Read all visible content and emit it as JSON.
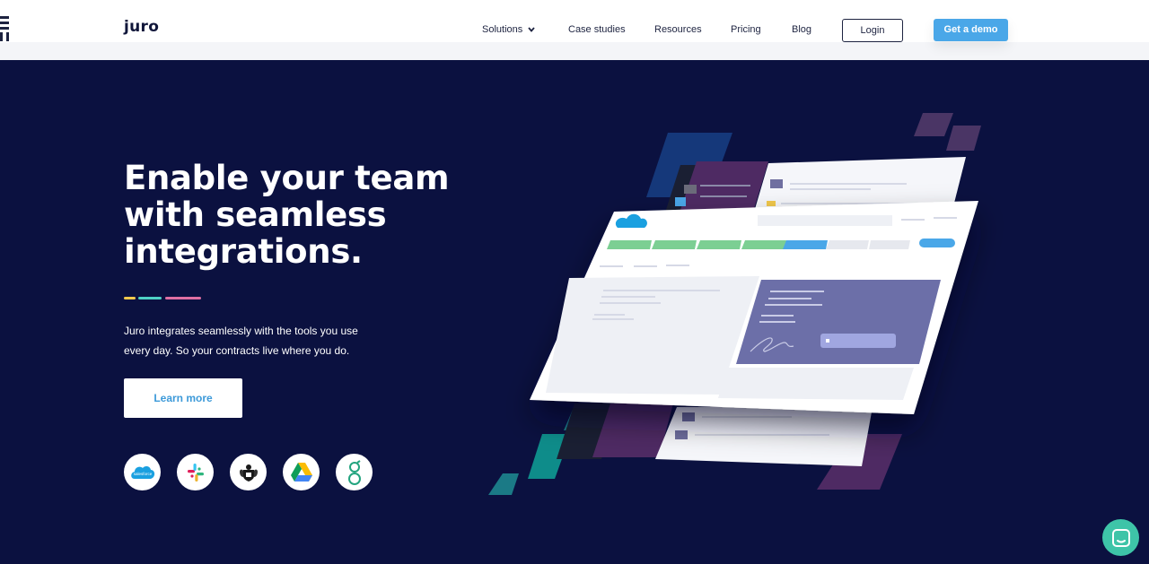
{
  "nav": {
    "logo": "juro",
    "items": [
      "Solutions",
      "Case studies",
      "Resources",
      "Pricing",
      "Blog"
    ],
    "login_label": "Login",
    "demo_label": "Get a demo"
  },
  "hero": {
    "title_lines": [
      "Enable your team",
      "with seamless",
      "integrations."
    ],
    "description_lines": [
      "Juro integrates seamlessly with the tools you use",
      "every day. So your contracts live where you do."
    ],
    "cta_label": "Learn more",
    "accent_bars": [
      "#f2c94c",
      "#4fd1c5",
      "#e06fa3"
    ]
  },
  "integrations": [
    {
      "name": "salesforce",
      "icon": "salesforce-icon",
      "text": "salesforce"
    },
    {
      "name": "slack",
      "icon": "slack-icon"
    },
    {
      "name": "crest",
      "icon": "crest-icon"
    },
    {
      "name": "google-drive",
      "icon": "google-drive-icon"
    },
    {
      "name": "greenhouse",
      "icon": "greenhouse-icon"
    }
  ],
  "colors": {
    "background": "#0b1140",
    "accent_blue": "#4aa7e8",
    "chat": "#3ec4a8"
  },
  "chat": {
    "icon": "chat-icon"
  }
}
